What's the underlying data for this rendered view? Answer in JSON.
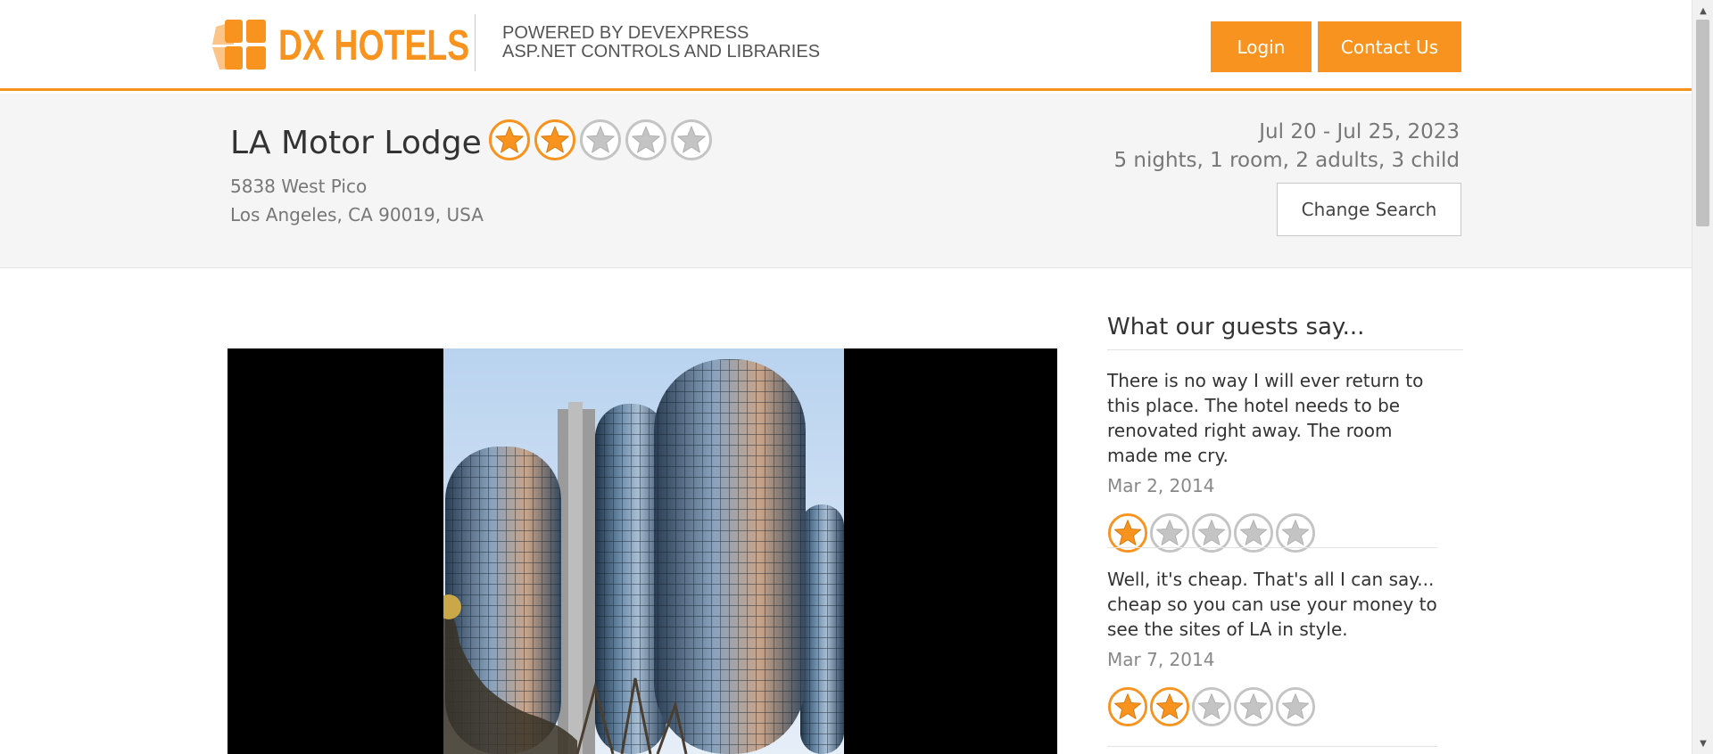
{
  "header": {
    "logo_text": "DX HOTELS",
    "powered_line1": "POWERED BY DEVEXPRESS",
    "powered_line2": "ASP.NET CONTROLS AND LIBRARIES",
    "login_label": "Login",
    "contact_label": "Contact Us"
  },
  "hotel": {
    "name": "LA Motor Lodge",
    "address_line1": "5838 West Pico",
    "address_line2": "Los Angeles, CA 90019, USA",
    "rating": 2,
    "max_rating": 5
  },
  "search": {
    "dates": "Jul 20 - Jul 25, 2023",
    "summary": "5 nights, 1 room, 2 adults, 3 child",
    "change_label": "Change Search"
  },
  "reviews": {
    "title": "What our guests say...",
    "items": [
      {
        "text": "There is no way I will ever return to this place. The hotel needs to be renovated right away. The room made me cry.",
        "date": "Mar 2, 2014",
        "rating": 1
      },
      {
        "text": "Well, it's cheap. That's all I can say... cheap so you can use your money to see the sites of LA in style.",
        "date": "Mar 7, 2014",
        "rating": 2
      }
    ]
  },
  "colors": {
    "accent": "#f7931e",
    "star_empty": "#c4c4c4",
    "band_bg": "#f5f5f5"
  },
  "icons": {
    "logo": "dx-hotels-logo-icon",
    "star": "star-icon",
    "scroll_up": "scroll-up-arrow-icon",
    "scroll_down": "scroll-down-arrow-icon"
  }
}
